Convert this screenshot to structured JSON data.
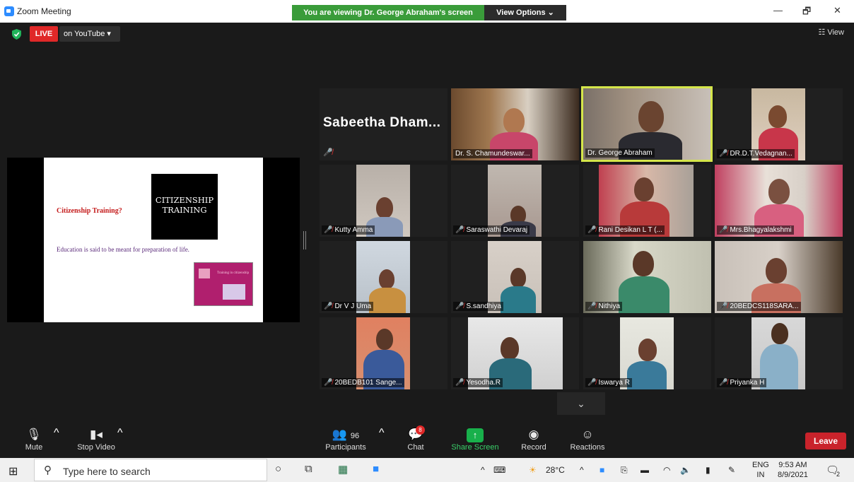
{
  "window": {
    "title": "Zoom Meeting",
    "minimize": "—",
    "restore": "🗗",
    "close": "✕"
  },
  "banner": {
    "viewing_text": "You are viewing Dr. George Abraham's screen",
    "view_options": "View Options ⌄"
  },
  "meeting_header": {
    "live": "LIVE",
    "youtube": "on YouTube ▾",
    "view": "☷ View"
  },
  "shared_slide": {
    "question": "Citizenship Training?",
    "art_text": "CITIZENSHIP TRAINING",
    "body": "Education is said to be meant for preparation of life.",
    "thumb_text": "Training in citizenship"
  },
  "participants": [
    {
      "name": "Sabeetha Dham...",
      "type": "name-only"
    },
    {
      "name": "Dr. S. Chamundeswar...",
      "type": "video"
    },
    {
      "name": "Dr. George Abraham",
      "type": "video",
      "speaking": true
    },
    {
      "name": "DR.D.T.Vedagnan...",
      "type": "video"
    },
    {
      "name": "Kutty Amma",
      "type": "video"
    },
    {
      "name": "Saraswathi Devaraj",
      "type": "video"
    },
    {
      "name": "Rani Desikan L T (...",
      "type": "video"
    },
    {
      "name": "Mrs.Bhagyalakshmi",
      "type": "video"
    },
    {
      "name": "Dr V J Uma",
      "type": "video"
    },
    {
      "name": "S.sandhiya",
      "type": "video"
    },
    {
      "name": "Nithiya",
      "type": "video"
    },
    {
      "name": "20BEDCS118SARA...",
      "type": "video"
    },
    {
      "name": "20BEDB101 Sange...",
      "type": "video"
    },
    {
      "name": "Yesodha.R",
      "type": "video"
    },
    {
      "name": "Iswarya R",
      "type": "video"
    },
    {
      "name": "Priyanka H",
      "type": "video"
    }
  ],
  "toolbar": {
    "mute": "Mute",
    "stop_video": "Stop Video",
    "participants_count": "96",
    "participants": "Participants",
    "chat": "Chat",
    "chat_badge": "8",
    "share_screen": "Share Screen",
    "record": "Record",
    "reactions": "Reactions",
    "leave": "Leave"
  },
  "taskbar": {
    "search_placeholder": "Type here to search",
    "temperature": "28°C",
    "lang_top": "ENG",
    "lang_bottom": "IN",
    "time": "9:53 AM",
    "date": "8/9/2021",
    "notif_count": "2"
  },
  "colors": {
    "live_red": "#e02828",
    "banner_green": "#3a9c3a",
    "speaker_border": "#d5e64a",
    "leave_red": "#c9232b",
    "share_green": "#18b04b"
  }
}
